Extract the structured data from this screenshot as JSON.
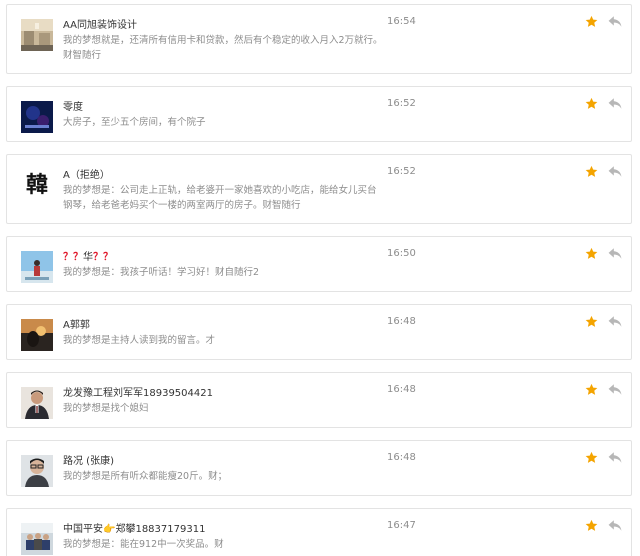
{
  "colors": {
    "accent_star": "#f4a400",
    "reply_icon": "#b7b7b7",
    "name_text": "#333333",
    "secondary_text": "#8d8d8d",
    "card_border": "#e3e3e3"
  },
  "messages": [
    {
      "name": "AA同旭装饰设计",
      "time": "16:54",
      "text": "我的梦想就是，还清所有信用卡和贷款，然后有个稳定的收入月入2万就行。财智随行",
      "avatar": "photo-room"
    },
    {
      "name": "零度",
      "time": "16:52",
      "text": "大房子，至少五个房间，有个院子",
      "avatar": "photo-dark-blue"
    },
    {
      "name": "A（拒绝）",
      "time": "16:52",
      "text": "我的梦想是：公司走上正轨，给老婆开一家她喜欢的小吃店，能给女儿买台钢琴，给老爸老妈买个一楼的两室两厅的房子。财智随行",
      "avatar": "text",
      "avatar_text": "韓"
    },
    {
      "name_prefix": "？？",
      "name_mid": "华",
      "name_suffix": "？？",
      "time": "16:50",
      "text": "我的梦想是：我孩子听话！学习好！财自随行2",
      "avatar": "photo-sky"
    },
    {
      "name": "A郭郭",
      "time": "16:48",
      "text": "我的梦想是主持人读到我的留言。才",
      "avatar": "photo-sunset"
    },
    {
      "name": "龙发豫工程刘军军18939504421",
      "time": "16:48",
      "text": "我的梦想是找个媳妇",
      "avatar": "photo-man-suit"
    },
    {
      "name": "路况 (张康)",
      "time": "16:48",
      "text": "我的梦想是所有听众都能瘦20斤。财；",
      "avatar": "photo-man-glasses"
    },
    {
      "name_prefix": "中国平安",
      "name_emoji": "👉",
      "name_suffix": "郑攀18837179311",
      "time": "16:47",
      "text": "我的梦想是：能在912中一次奖品。财",
      "avatar": "photo-group"
    }
  ]
}
